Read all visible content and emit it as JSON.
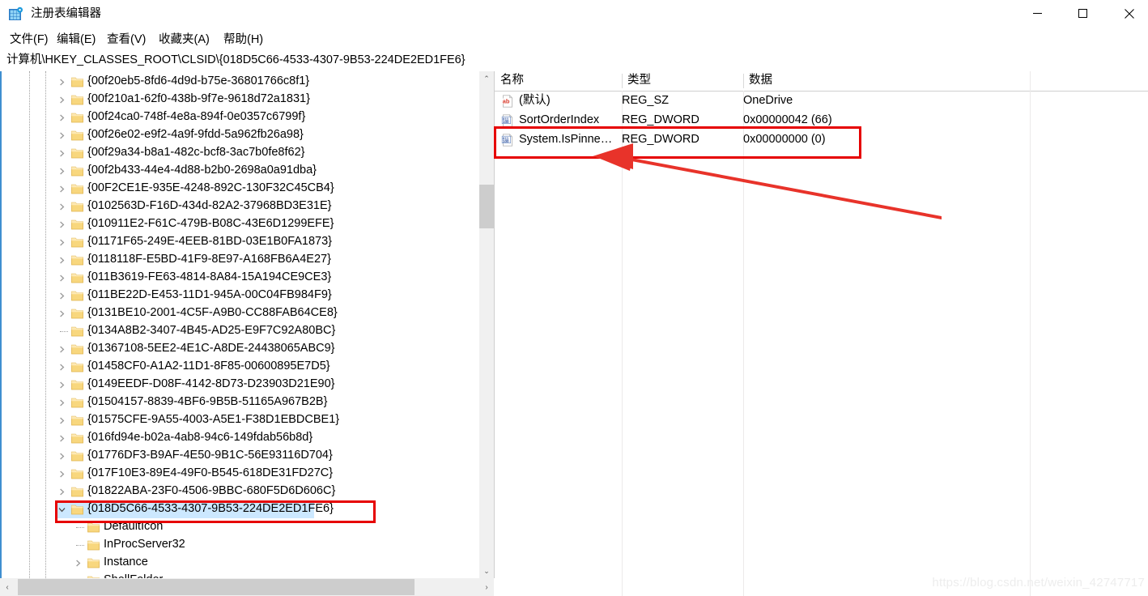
{
  "window": {
    "title": "注册表编辑器",
    "icon": "regedit-icon",
    "controls": {
      "minimize": "—",
      "maximize": "▢",
      "close": "✕"
    }
  },
  "menubar": {
    "items": [
      {
        "label": "文件(F)",
        "name": "menu-file"
      },
      {
        "label": "编辑(E)",
        "name": "menu-edit"
      },
      {
        "label": "查看(V)",
        "name": "menu-view"
      },
      {
        "label": "收藏夹(A)",
        "name": "menu-favorites"
      },
      {
        "label": "帮助(H)",
        "name": "menu-help"
      }
    ]
  },
  "address": {
    "path": "计算机\\HKEY_CLASSES_ROOT\\CLSID\\{018D5C66-4533-4307-9B53-224DE2ED1FE6}"
  },
  "tree": {
    "items": [
      {
        "label": "{00f20eb5-8fd6-4d9d-b75e-36801766c8f1}",
        "depth": 3,
        "expandable": true,
        "expanded": false,
        "selected": false
      },
      {
        "label": "{00f210a1-62f0-438b-9f7e-9618d72a1831}",
        "depth": 3,
        "expandable": true,
        "expanded": false,
        "selected": false
      },
      {
        "label": "{00f24ca0-748f-4e8a-894f-0e0357c6799f}",
        "depth": 3,
        "expandable": true,
        "expanded": false,
        "selected": false
      },
      {
        "label": "{00f26e02-e9f2-4a9f-9fdd-5a962fb26a98}",
        "depth": 3,
        "expandable": true,
        "expanded": false,
        "selected": false
      },
      {
        "label": "{00f29a34-b8a1-482c-bcf8-3ac7b0fe8f62}",
        "depth": 3,
        "expandable": true,
        "expanded": false,
        "selected": false
      },
      {
        "label": "{00f2b433-44e4-4d88-b2b0-2698a0a91dba}",
        "depth": 3,
        "expandable": true,
        "expanded": false,
        "selected": false
      },
      {
        "label": "{00F2CE1E-935E-4248-892C-130F32C45CB4}",
        "depth": 3,
        "expandable": true,
        "expanded": false,
        "selected": false
      },
      {
        "label": "{0102563D-F16D-434d-82A2-37968BD3E31E}",
        "depth": 3,
        "expandable": true,
        "expanded": false,
        "selected": false
      },
      {
        "label": "{010911E2-F61C-479B-B08C-43E6D1299EFE}",
        "depth": 3,
        "expandable": true,
        "expanded": false,
        "selected": false
      },
      {
        "label": "{01171F65-249E-4EEB-81BD-03E1B0FA1873}",
        "depth": 3,
        "expandable": true,
        "expanded": false,
        "selected": false
      },
      {
        "label": "{0118118F-E5BD-41F9-8E97-A168FB6A4E27}",
        "depth": 3,
        "expandable": true,
        "expanded": false,
        "selected": false
      },
      {
        "label": "{011B3619-FE63-4814-8A84-15A194CE9CE3}",
        "depth": 3,
        "expandable": true,
        "expanded": false,
        "selected": false
      },
      {
        "label": "{011BE22D-E453-11D1-945A-00C04FB984F9}",
        "depth": 3,
        "expandable": true,
        "expanded": false,
        "selected": false
      },
      {
        "label": "{0131BE10-2001-4C5F-A9B0-CC88FAB64CE8}",
        "depth": 3,
        "expandable": true,
        "expanded": false,
        "selected": false
      },
      {
        "label": "{0134A8B2-3407-4B45-AD25-E9F7C92A80BC}",
        "depth": 3,
        "expandable": false,
        "expanded": false,
        "selected": false
      },
      {
        "label": "{01367108-5EE2-4E1C-A8DE-24438065ABC9}",
        "depth": 3,
        "expandable": true,
        "expanded": false,
        "selected": false
      },
      {
        "label": "{01458CF0-A1A2-11D1-8F85-00600895E7D5}",
        "depth": 3,
        "expandable": true,
        "expanded": false,
        "selected": false
      },
      {
        "label": "{0149EEDF-D08F-4142-8D73-D23903D21E90}",
        "depth": 3,
        "expandable": true,
        "expanded": false,
        "selected": false
      },
      {
        "label": "{01504157-8839-4BF6-9B5B-51165A967B2B}",
        "depth": 3,
        "expandable": true,
        "expanded": false,
        "selected": false
      },
      {
        "label": "{01575CFE-9A55-4003-A5E1-F38D1EBDCBE1}",
        "depth": 3,
        "expandable": true,
        "expanded": false,
        "selected": false
      },
      {
        "label": "{016fd94e-b02a-4ab8-94c6-149fdab56b8d}",
        "depth": 3,
        "expandable": true,
        "expanded": false,
        "selected": false
      },
      {
        "label": "{01776DF3-B9AF-4E50-9B1C-56E93116D704}",
        "depth": 3,
        "expandable": true,
        "expanded": false,
        "selected": false
      },
      {
        "label": "{017F10E3-89E4-49F0-B545-618DE31FD27C}",
        "depth": 3,
        "expandable": true,
        "expanded": false,
        "selected": false
      },
      {
        "label": "{01822ABA-23F0-4506-9BBC-680F5D6D606C}",
        "depth": 3,
        "expandable": true,
        "expanded": false,
        "selected": false
      },
      {
        "label": "{018D5C66-4533-4307-9B53-224DE2ED1FE6}",
        "depth": 3,
        "expandable": true,
        "expanded": true,
        "selected": true
      },
      {
        "label": "DefaultIcon",
        "depth": 4,
        "expandable": false,
        "expanded": false,
        "selected": false
      },
      {
        "label": "InProcServer32",
        "depth": 4,
        "expandable": false,
        "expanded": false,
        "selected": false
      },
      {
        "label": "Instance",
        "depth": 4,
        "expandable": true,
        "expanded": false,
        "selected": false
      },
      {
        "label": "ShellFolder",
        "depth": 4,
        "expandable": false,
        "expanded": false,
        "selected": false
      }
    ]
  },
  "values": {
    "columns": [
      "名称",
      "类型",
      "数据"
    ],
    "rows": [
      {
        "name": "(默认)",
        "type": "REG_SZ",
        "data": "OneDrive",
        "icon": "string-value-icon",
        "highlighted": false
      },
      {
        "name": "SortOrderIndex",
        "type": "REG_DWORD",
        "data": "0x00000042 (66)",
        "icon": "dword-value-icon",
        "highlighted": false
      },
      {
        "name": "System.IsPinne…",
        "type": "REG_DWORD",
        "data": "0x00000000 (0)",
        "icon": "dword-value-icon",
        "highlighted": true
      }
    ]
  },
  "scrollbars": {
    "vertical": {
      "up": "⌃",
      "down": "⌄"
    },
    "horizontal": {
      "left": "‹",
      "right": "›"
    }
  },
  "annotations": {
    "color": "#e60000",
    "tree_highlight": "{018D5C66-4533-4307-9B53-224DE2ED1FE6}",
    "value_highlight": "System.IsPinne…",
    "arrow": "points-to-system-ispinned-row"
  },
  "watermark": {
    "text": "https://blog.csdn.net/weixin_42747717"
  }
}
